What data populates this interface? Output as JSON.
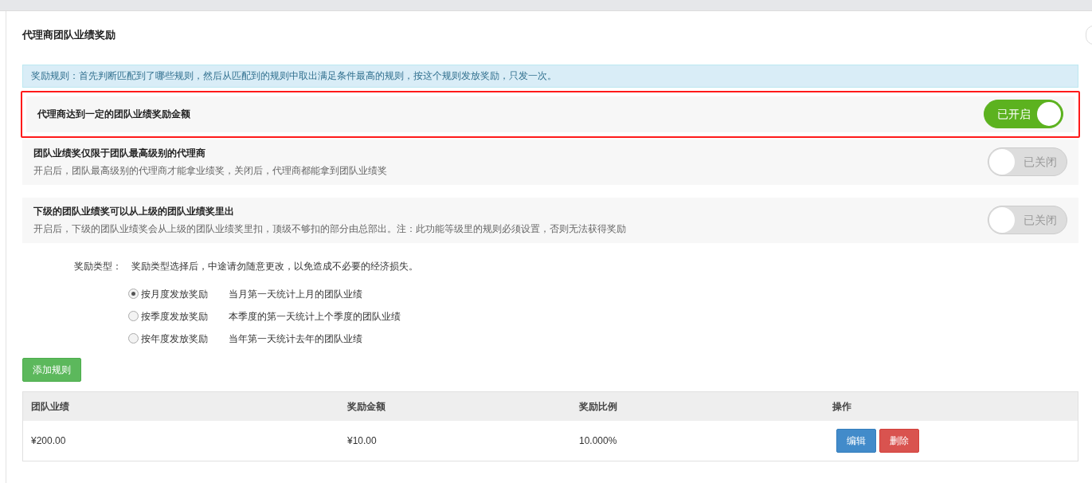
{
  "title": "代理商团队业绩奖励",
  "notice": "奖励规则：首先判断匹配到了哪些规则，然后从匹配到的规则中取出满足条件最高的规则，按这个规则发放奖励，只发一次。",
  "settings": [
    {
      "title": "代理商达到一定的团队业绩奖励金额",
      "on": true,
      "switch_label": "已开启",
      "highlighted": true
    },
    {
      "title": "团队业绩奖仅限于团队最高级别的代理商",
      "description": "开启后，团队最高级别的代理商才能拿业绩奖，关闭后，代理商都能拿到团队业绩奖",
      "on": false,
      "switch_label": "已关闭",
      "highlighted": false
    },
    {
      "title": "下级的团队业绩奖可以从上级的团队业绩奖里出",
      "description": "开启后，下级的团队业绩奖会从上级的团队业绩奖里扣，顶级不够扣的部分由总部出。注：此功能等级里的规则必须设置，否则无法获得奖励",
      "on": false,
      "switch_label": "已关闭",
      "highlighted": false
    }
  ],
  "reward_type": {
    "label": "奖励类型：",
    "hint": "奖励类型选择后，中途请勿随意更改，以免造成不必要的经济损失。",
    "options": [
      {
        "label": "按月度发放奖励",
        "description": "当月第一天统计上月的团队业绩",
        "selected": true
      },
      {
        "label": "按季度发放奖励",
        "description": "本季度的第一天统计上个季度的团队业绩",
        "selected": false
      },
      {
        "label": "按年度发放奖励",
        "description": "当年第一天统计去年的团队业绩",
        "selected": false
      }
    ]
  },
  "add_button": "添加规则",
  "table": {
    "columns": [
      "团队业绩",
      "奖励金额",
      "奖励比例",
      "操作"
    ],
    "rows": [
      {
        "cells": [
          "¥200.00",
          "¥10.00",
          "10.000%"
        ],
        "actions": [
          {
            "kind": "edit",
            "label": "编辑"
          },
          {
            "kind": "delete",
            "label": "删除"
          }
        ]
      }
    ]
  }
}
